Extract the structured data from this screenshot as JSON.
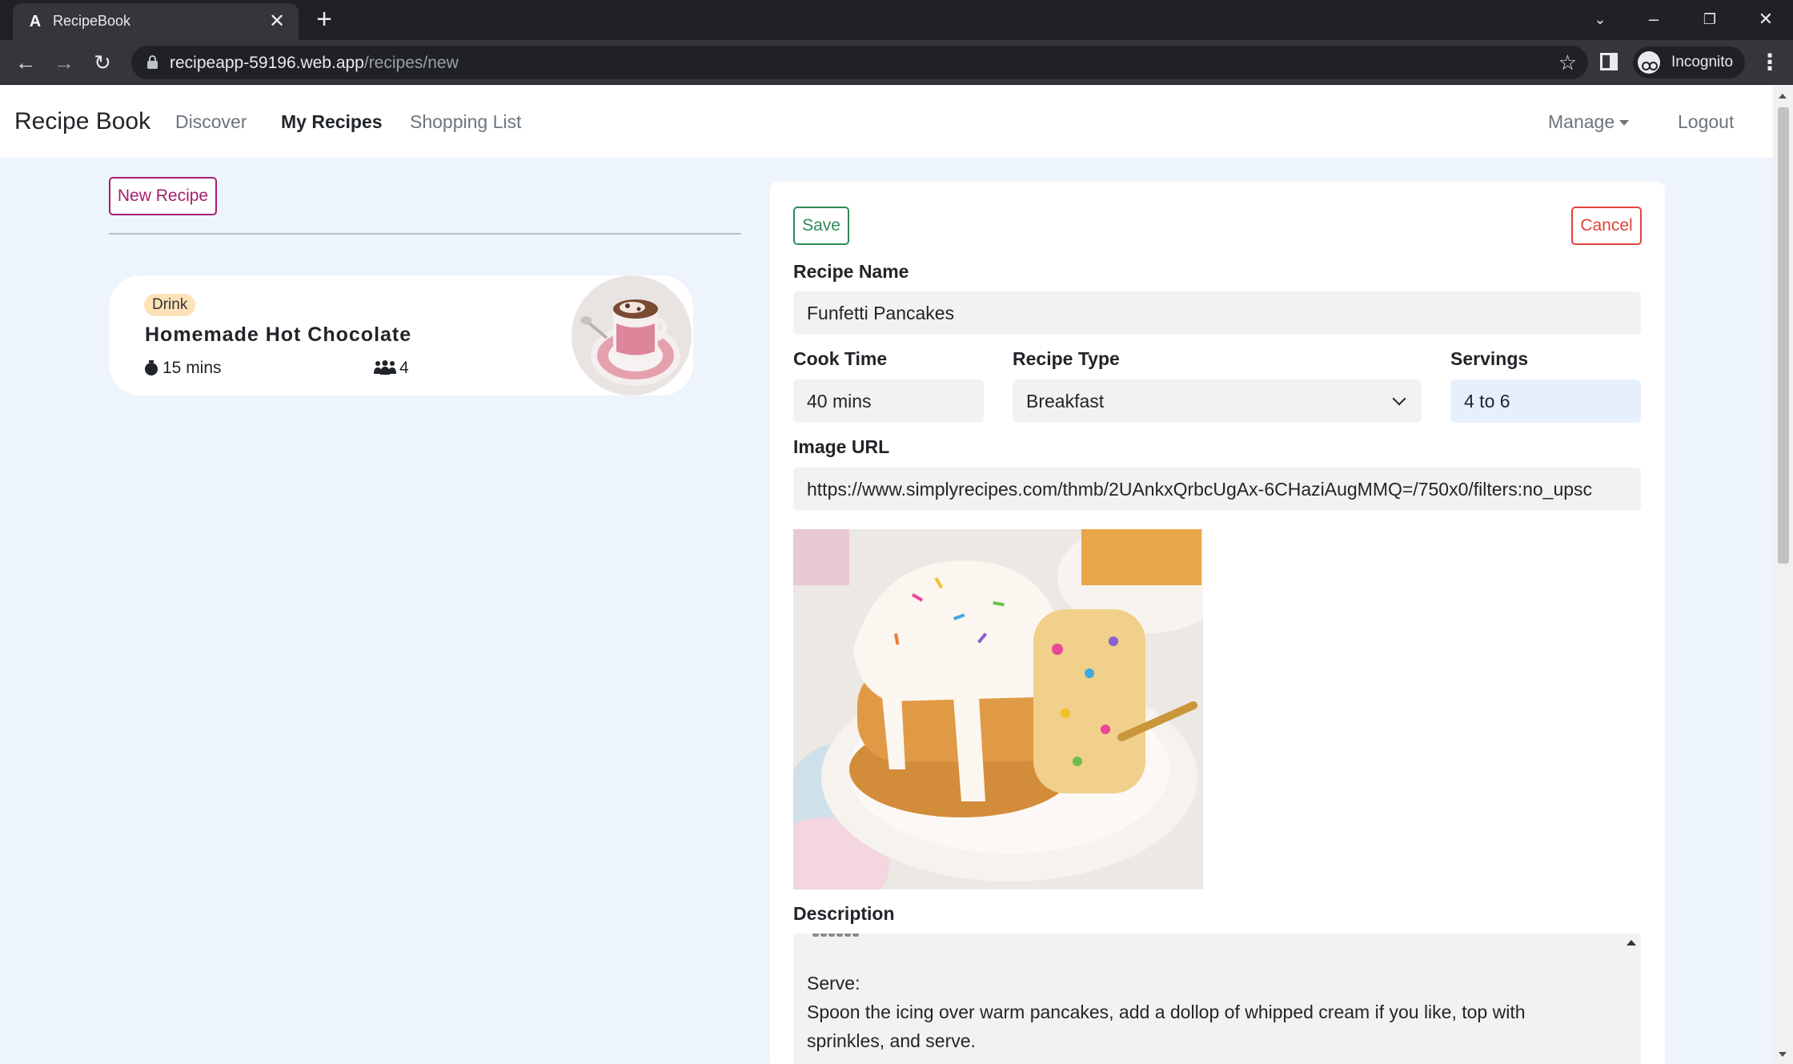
{
  "browser": {
    "tab_title": "RecipeBook",
    "url_host": "recipeapp-59196.web.app",
    "url_path": "/recipes/new",
    "profile_label": "Incognito"
  },
  "nav": {
    "brand": "Recipe Book",
    "links": [
      "Discover",
      "My Recipes",
      "Shopping List"
    ],
    "active": "My Recipes",
    "manage": "Manage",
    "logout": "Logout"
  },
  "sidebar": {
    "new_recipe_label": "New Recipe",
    "recipes": [
      {
        "type": "Drink",
        "name": "Homemade Hot Chocolate",
        "cook_time": "15 mins",
        "servings": "4"
      }
    ]
  },
  "form": {
    "save_label": "Save",
    "cancel_label": "Cancel",
    "recipe_name_label": "Recipe Name",
    "recipe_name": "Funfetti Pancakes",
    "cook_time_label": "Cook Time",
    "cook_time": "40 mins",
    "recipe_type_label": "Recipe Type",
    "recipe_type": "Breakfast",
    "servings_label": "Servings",
    "servings": "4 to 6",
    "image_url_label": "Image URL",
    "image_url": "https://www.simplyrecipes.com/thmb/2UAnkxQrbcUgAx-6CHaziAugMMQ=/750x0/filters:no_upsc",
    "description_label": "Description",
    "description_lines": [
      "Serve:",
      "Spoon the icing over warm pancakes, add a dollop of whipped cream if you like, top with",
      "sprinkles, and serve."
    ]
  },
  "colors": {
    "accent": "#a3206f",
    "save": "#2e8b57",
    "cancel": "#e0443e",
    "page_bg": "#eef4fb",
    "badge_bg": "#fde2b8"
  }
}
